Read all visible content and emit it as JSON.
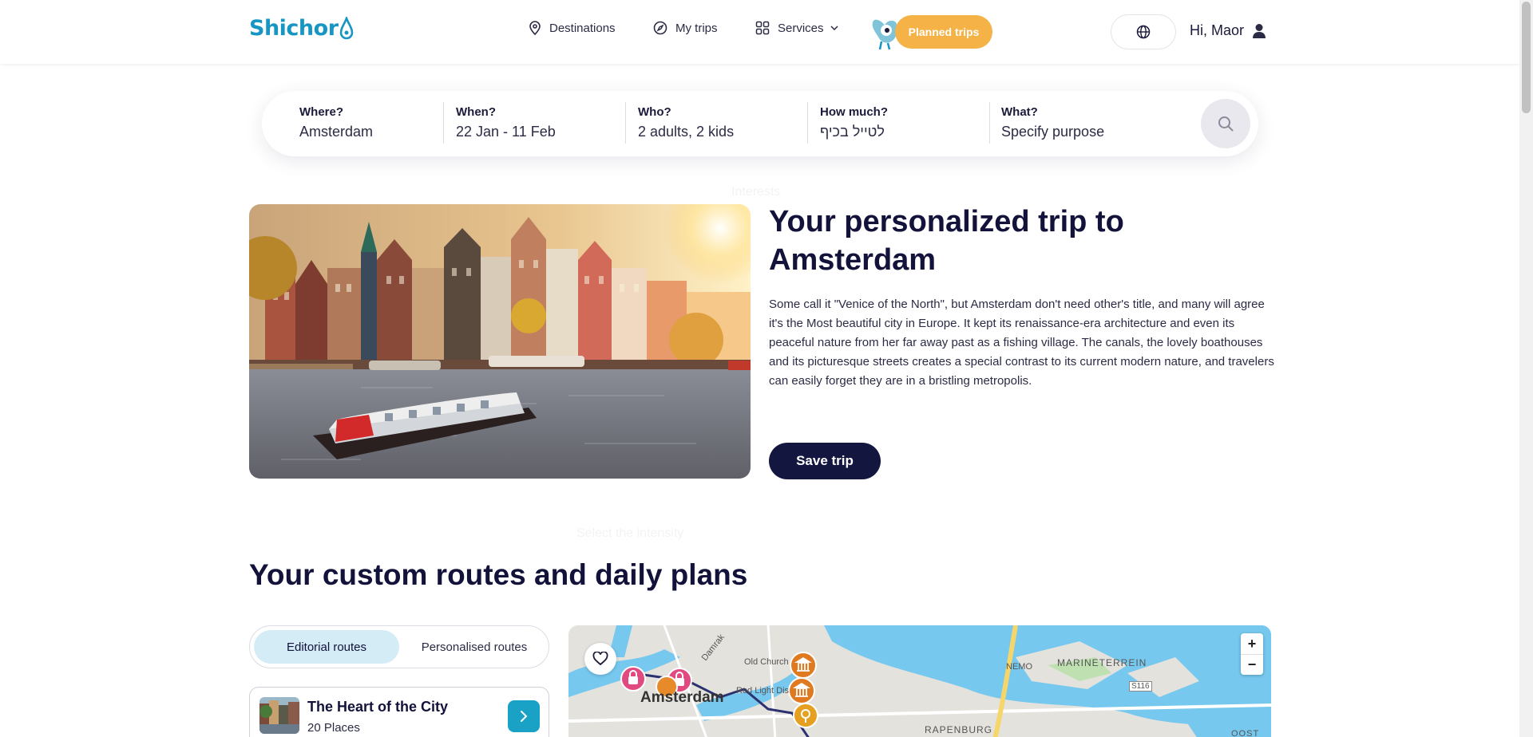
{
  "header": {
    "logo_text": "Shichor",
    "nav": {
      "destinations": "Destinations",
      "my_trips": "My trips",
      "services": "Services"
    },
    "planned_trips": "Planned trips",
    "greeting": "Hi, Maor"
  },
  "search": {
    "where": {
      "label": "Where?",
      "value": "Amsterdam"
    },
    "when": {
      "label": "When?",
      "value": "22 Jan - 11 Feb"
    },
    "who": {
      "label": "Who?",
      "value": "2 adults, 2 kids"
    },
    "how_much": {
      "label": "How much?",
      "value": "לטייל בכיף"
    },
    "what": {
      "label": "What?",
      "value": "Specify purpose"
    }
  },
  "hero": {
    "title": "Your personalized trip to Amsterdam",
    "description": "Some call it \"Venice of the North\", but Amsterdam don't need other's title, and many will agree it's the Most beautiful city in Europe. It kept its renaissance-era architecture and even its peaceful nature from her far away past as a fishing village. The canals, the lovely boathouses and its picturesque streets creates a special contrast to its current modern nature, and travelers can easily forget they are in a bristling metropolis.",
    "save_button": "Save trip"
  },
  "ghost_overlay": {
    "interests": "Interests",
    "select_intensity": "Select the intensity"
  },
  "routes": {
    "title": "Your custom routes and daily plans",
    "tabs": [
      "Editorial routes",
      "Personalised routes"
    ],
    "active_tab": "Editorial routes",
    "cards": [
      {
        "name": "The Heart of the City",
        "places": "20 Places"
      }
    ]
  },
  "map": {
    "labels": {
      "damrak": "Damrak",
      "old_church": "Old Church",
      "red_light": "Red Light Dis",
      "city": "Amsterdam",
      "nemo": "NEMO",
      "marineterrein": "MARINETERREIN",
      "s116": "S116",
      "rapenburg": "RAPENBURG",
      "oost": "OOST"
    },
    "zoom_in": "+",
    "zoom_out": "−"
  },
  "colors": {
    "brand": "#1796c4",
    "accent_orange": "#f5b246",
    "navy": "#13163f",
    "tab_active": "#d4ecf6",
    "route_button": "#1aa1c6"
  }
}
